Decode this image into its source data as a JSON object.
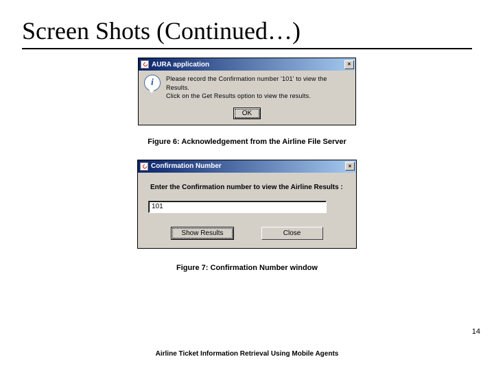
{
  "slide": {
    "title": "Screen Shots (Continued…)",
    "page_number": "14",
    "footer": "Airline Ticket Information Retrieval Using Mobile Agents"
  },
  "dialog1": {
    "title": "AURA application",
    "msg_line1": "Please record the Confirmation number '101' to view the Results.",
    "msg_line2": "Click on the Get Results option to view the results.",
    "ok_label": "OK",
    "close_label": "×"
  },
  "caption1": "Figure 6: Acknowledgement from the Airline File Server",
  "dialog2": {
    "title": "Confirmation Number",
    "prompt": "Enter the Confirmation number to view the Airline Results :",
    "input_value": "101",
    "show_results_label": "Show Results",
    "close_label": "Close",
    "close_x": "×"
  },
  "caption2": "Figure 7: Confirmation Number window"
}
